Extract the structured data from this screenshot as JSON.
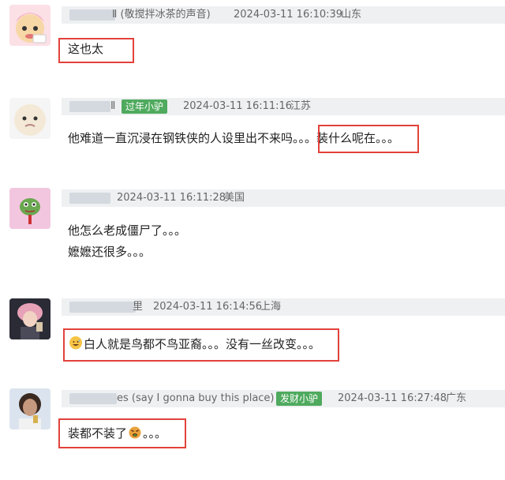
{
  "comments": [
    {
      "name_partial": "Ⅱ (敬搅拌冰茶的声音)",
      "timestamp": "2024-03-11 16:10:39",
      "location": "山东",
      "lines": [
        "这也太"
      ]
    },
    {
      "name_partial": "Ⅱ",
      "badge": "过年小驴",
      "timestamp": "2024-03-11 16:11:16",
      "location": "江苏",
      "line_prefix": "他难道一直沉浸在钢铁侠的人设里出不来吗。。",
      "line_highlight": "。装什么呢在。。。"
    },
    {
      "timestamp": "2024-03-11 16:11:28",
      "location": "美国",
      "lines": [
        "他怎么老成僵尸了。。。",
        "嬷嬷还很多。。。"
      ]
    },
    {
      "name_partial": "里",
      "timestamp": "2024-03-11 16:14:56",
      "location": "上海",
      "emoji": "grinning-sweat-emoji",
      "lines": [
        "白人就是鸟都不鸟亚裔。。。没有一丝改变。。。"
      ]
    },
    {
      "name_partial": "es (say I gonna buy this place)",
      "badge": "发财小驴",
      "timestamp": "2024-03-11 16:27:48",
      "location": "广东",
      "emoji": "angry-emoji",
      "line_prefix": "装都不装了",
      "line_suffix": "。。。"
    }
  ],
  "colors": {
    "meta_bar": "#eef0f2",
    "highlight_box": "#e2423b",
    "badge": "#4faa5e"
  }
}
